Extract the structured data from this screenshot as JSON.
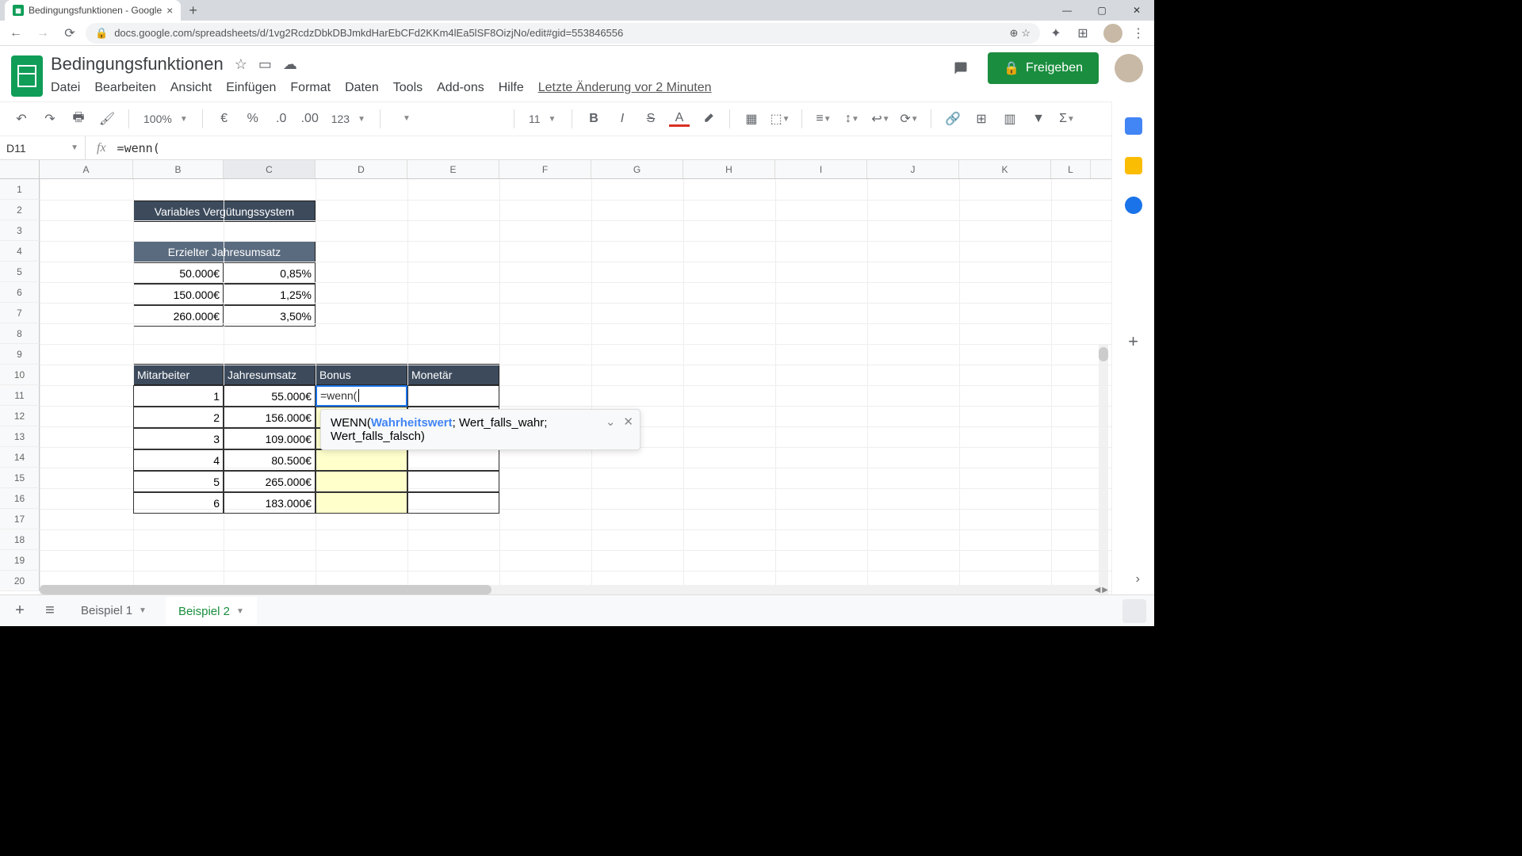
{
  "browser": {
    "tab_title": "Bedingungsfunktionen - Google",
    "url": "docs.google.com/spreadsheets/d/1vg2RcdzDbkDBJmkdHarEbCFd2KKm4lEa5lSF8OizjNo/edit#gid=553846556"
  },
  "doc": {
    "name": "Bedingungsfunktionen",
    "share_label": "Freigeben",
    "last_edit": "Letzte Änderung vor 2 Minuten"
  },
  "menu": {
    "file": "Datei",
    "edit": "Bearbeiten",
    "view": "Ansicht",
    "insert": "Einfügen",
    "format": "Format",
    "data": "Daten",
    "tools": "Tools",
    "addons": "Add-ons",
    "help": "Hilfe"
  },
  "toolbar": {
    "zoom": "100%",
    "font_size": "11"
  },
  "formula_bar": {
    "cell_ref": "D11",
    "formula": "=wenn("
  },
  "sheet": {
    "columns": [
      "A",
      "B",
      "C",
      "D",
      "E",
      "F",
      "G",
      "H",
      "I",
      "J",
      "K",
      "L"
    ],
    "title_1": "Variables Vergütungssystem",
    "title_2": "Erzielter Jahresumsatz",
    "tier_rows": [
      {
        "amount": "50.000€",
        "pct": "0,85%"
      },
      {
        "amount": "150.000€",
        "pct": "1,25%"
      },
      {
        "amount": "260.000€",
        "pct": "3,50%"
      }
    ],
    "table_headers": {
      "a": "Mitarbeiter",
      "b": "Jahresumsatz",
      "c": "Bonus",
      "d": "Monetär"
    },
    "employees": [
      {
        "id": "1",
        "rev": "55.000€"
      },
      {
        "id": "2",
        "rev": "156.000€"
      },
      {
        "id": "3",
        "rev": "109.000€"
      },
      {
        "id": "4",
        "rev": "80.500€"
      },
      {
        "id": "5",
        "rev": "265.000€"
      },
      {
        "id": "6",
        "rev": "183.000€"
      }
    ],
    "editing_formula": "=wenn("
  },
  "tooltip": {
    "func": "WENN(",
    "arg1": "Wahrheitswert",
    "rest1": "; Wert_falls_wahr;",
    "rest2": "Wert_falls_falsch)"
  },
  "tabs": {
    "tab1": "Beispiel 1",
    "tab2": "Beispiel 2"
  }
}
